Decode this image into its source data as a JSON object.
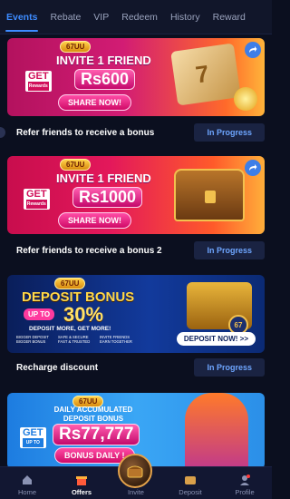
{
  "tabs": [
    {
      "label": "Events"
    },
    {
      "label": "Rebate"
    },
    {
      "label": "VIP"
    },
    {
      "label": "Redeem"
    },
    {
      "label": "History"
    },
    {
      "label": "Reward"
    }
  ],
  "brand": "67UU",
  "banners": [
    {
      "headline": "INVITE 1 FRIEND",
      "get": "GET",
      "get_sub": "Rewards",
      "amount": "Rs600",
      "cta": "SHARE NOW!",
      "row_title": "Refer friends to receive a bonus",
      "status": "In Progress"
    },
    {
      "headline": "INVITE 1 FRIEND",
      "get": "GET",
      "get_sub": "Rewards",
      "amount": "Rs1000",
      "cta": "SHARE NOW!",
      "row_title": "Refer friends to receive a bonus 2",
      "status": "In Progress"
    },
    {
      "headline": "DEPOSIT BONUS",
      "up_to": "UP TO",
      "amount": "30%",
      "tagline": "DEPOSIT MORE, GET MORE!",
      "cta": "DEPOSIT NOW! >>",
      "features": [
        "BIGGER DEPOSIT BIGGER BONUS",
        "SAFE & SECURE FAST & TRUSTED",
        "INVITE FRIENDS EARN TOGETHER"
      ],
      "row_title": "Recharge discount",
      "status": "In Progress"
    },
    {
      "headline": "DAILY ACCUMULATED DEPOSIT BONUS",
      "get": "GET",
      "get_sub": "UP TO",
      "amount": "Rs77,777",
      "cta": "BONUS DAILY !"
    }
  ],
  "bottom_nav": [
    {
      "label": "Home",
      "icon": "home-icon"
    },
    {
      "label": "Offers",
      "icon": "gift-icon"
    },
    {
      "label": "Invite",
      "icon": "chest-icon"
    },
    {
      "label": "Deposit",
      "icon": "wallet-icon"
    },
    {
      "label": "Profile",
      "icon": "profile-icon"
    }
  ],
  "colors": {
    "background": "#0b0f1f",
    "accent": "#3d8bff",
    "status_text": "#6ea6ff"
  }
}
